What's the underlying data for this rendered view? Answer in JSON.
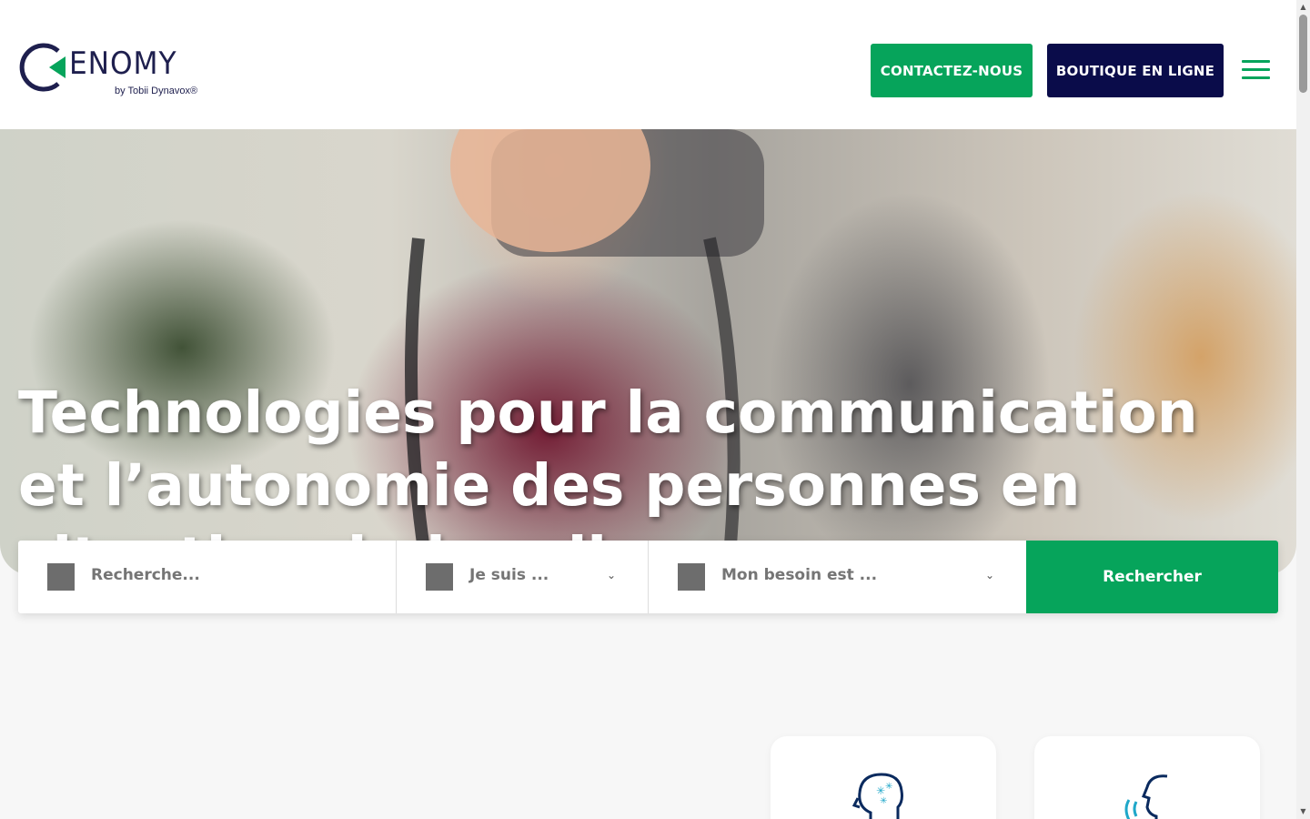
{
  "header": {
    "logo": {
      "wordmark": "ENOMY",
      "tagline": "by Tobii Dynavox®"
    },
    "contact_label": "CONTACTEZ-NOUS",
    "shop_label": "BOUTIQUE EN LIGNE",
    "menu_icon": "hamburger-menu-icon"
  },
  "hero": {
    "title": "Technologies pour la communication et l’autonomie des personnes en situation de handicap"
  },
  "search": {
    "query_placeholder": "Recherche...",
    "who_label": "Je suis ...",
    "need_label": "Mon besoin est ...",
    "submit_label": "Rechercher"
  },
  "cards": [
    {
      "icon": "head-sparkle-icon"
    },
    {
      "icon": "head-speech-icon"
    }
  ],
  "colors": {
    "green": "#06a45b",
    "navy": "#0a0c4a",
    "logo_navy": "#1e1f4e"
  }
}
